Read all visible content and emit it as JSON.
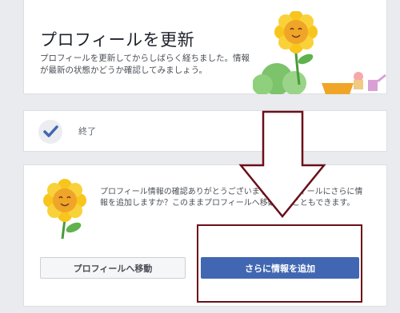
{
  "card_update": {
    "title": "プロフィールを更新",
    "description": "プロフィールを更新してからしばらく経ちました。情報が最新の状態かどうか確認してみましょう。"
  },
  "card_done": {
    "label": "終了"
  },
  "card_add": {
    "text": "プロフィール情報の確認ありがとうございます。プロフィールにさらに情報を追加しますか？このままプロフィールへ移動することもできます。",
    "btn_profile": "プロフィールへ移動",
    "btn_add": "さらに情報を追加"
  },
  "colors": {
    "primary": "#4267b2",
    "highlight": "#6b0f1a",
    "background": "#e9ebee"
  }
}
